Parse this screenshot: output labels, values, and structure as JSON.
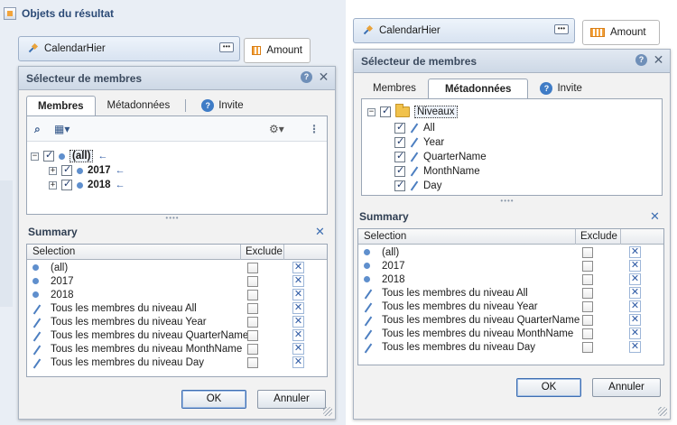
{
  "left": {
    "header_title": "Objets du résultat",
    "hier_chip": "CalendarHier",
    "measure_chip": "Amount",
    "dialog_title": "Sélecteur de membres",
    "tabs": [
      "Membres",
      "Métadonnées",
      "Invite"
    ],
    "active_tab": "Membres",
    "tree": [
      {
        "label": "(all)",
        "level": 0,
        "bold": true,
        "selected": true,
        "arrow": "←"
      },
      {
        "label": "2017",
        "level": 1,
        "bold": true,
        "arrow": "←"
      },
      {
        "label": "2018",
        "level": 1,
        "bold": true,
        "arrow": "←"
      }
    ],
    "summary_title": "Summary",
    "col_selection": "Selection",
    "col_exclude": "Exclude",
    "summary_rows": [
      {
        "icon": "dot",
        "label": "(all)"
      },
      {
        "icon": "dot",
        "label": "2017"
      },
      {
        "icon": "dot",
        "label": "2018"
      },
      {
        "icon": "level",
        "label": "Tous les membres du niveau All"
      },
      {
        "icon": "level",
        "label": "Tous les membres du niveau Year"
      },
      {
        "icon": "level",
        "label": "Tous les membres du niveau QuarterName"
      },
      {
        "icon": "level",
        "label": "Tous les membres du niveau MonthName"
      },
      {
        "icon": "level",
        "label": "Tous les membres du niveau Day"
      }
    ],
    "ok": "OK",
    "cancel": "Annuler"
  },
  "right": {
    "hier_chip": "CalendarHier",
    "measure_chip": "Amount",
    "dialog_title": "Sélecteur de membres",
    "tabs": [
      "Membres",
      "Métadonnées",
      "Invite"
    ],
    "active_tab": "Métadonnées",
    "tree_root": "Niveaux",
    "tree": [
      "All",
      "Year",
      "QuarterName",
      "MonthName",
      "Day"
    ],
    "summary_title": "Summary",
    "col_selection": "Selection",
    "col_exclude": "Exclude",
    "summary_rows": [
      {
        "icon": "dot",
        "label": "(all)"
      },
      {
        "icon": "dot",
        "label": "2017"
      },
      {
        "icon": "dot",
        "label": "2018"
      },
      {
        "icon": "level",
        "label": "Tous les membres du niveau All"
      },
      {
        "icon": "level",
        "label": "Tous les membres du niveau Year"
      },
      {
        "icon": "level",
        "label": "Tous les membres du niveau QuarterName"
      },
      {
        "icon": "level",
        "label": "Tous les membres du niveau MonthName"
      },
      {
        "icon": "level",
        "label": "Tous les membres du niveau Day"
      }
    ],
    "ok": "OK",
    "cancel": "Annuler"
  },
  "icons": {
    "hierarchy": "hierarchy-icon",
    "measure": "measure-icon",
    "help": "help-icon",
    "close": "close-icon",
    "search": "binoculars-icon",
    "structure": "tree-structure-icon",
    "tools": "wrench-icon",
    "folder": "folder-icon",
    "remove": "remove-x-icon"
  }
}
